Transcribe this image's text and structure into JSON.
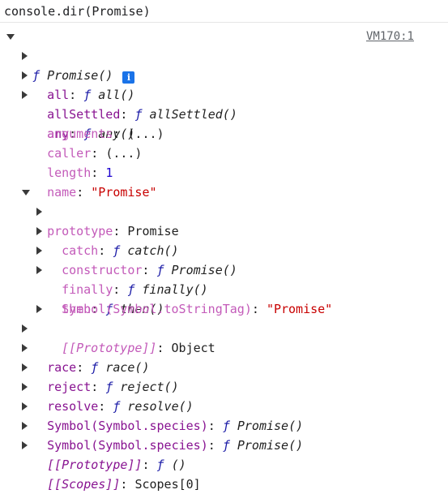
{
  "command": "console.dir(Promise)",
  "source_link": "VM170:1",
  "root": {
    "f": "ƒ",
    "name": "Promise()",
    "info_icon": "i"
  },
  "rows": [
    {
      "key": "all",
      "sep": ": ",
      "f": "ƒ",
      "val": "all()"
    },
    {
      "key": "allSettled",
      "sep": ": ",
      "f": "ƒ",
      "val": "allSettled()"
    },
    {
      "key": "any",
      "sep": ": ",
      "f": "ƒ",
      "val": "any()"
    },
    {
      "key": "arguments",
      "sep": ": ",
      "val": "(...)"
    },
    {
      "key": "caller",
      "sep": ": ",
      "val": "(...)"
    },
    {
      "key": "length",
      "sep": ": ",
      "val": "1"
    },
    {
      "key": "name",
      "sep": ": ",
      "val": "\"Promise\""
    },
    {
      "key": "prototype",
      "sep": ": ",
      "val": "Promise"
    },
    {
      "key": "catch",
      "sep": ": ",
      "f": "ƒ",
      "val": "catch()"
    },
    {
      "key": "constructor",
      "sep": ": ",
      "f": "ƒ",
      "val": "Promise()"
    },
    {
      "key": "finally",
      "sep": ": ",
      "f": "ƒ",
      "val": "finally()"
    },
    {
      "key": "then",
      "sep": ": ",
      "f": "ƒ",
      "val": "then()"
    },
    {
      "key": "Symbol(Symbol.toStringTag)",
      "sep": ": ",
      "val": "\"Promise\""
    },
    {
      "key": "[[Prototype]]",
      "sep": ": ",
      "val": "Object"
    },
    {
      "key": "race",
      "sep": ": ",
      "f": "ƒ",
      "val": "race()"
    },
    {
      "key": "reject",
      "sep": ": ",
      "f": "ƒ",
      "val": "reject()"
    },
    {
      "key": "resolve",
      "sep": ": ",
      "f": "ƒ",
      "val": "resolve()"
    },
    {
      "key": "Symbol(Symbol.species)",
      "sep": ": ",
      "f": "ƒ",
      "val": "Promise()"
    },
    {
      "key": "Symbol(Symbol.species)",
      "sep": ": ",
      "f": "ƒ",
      "val": "Promise()"
    },
    {
      "key": "[[Prototype]]",
      "sep": ": ",
      "f": "ƒ",
      "val": "()"
    },
    {
      "key": "[[Scopes]]",
      "sep": ": ",
      "val": "Scopes[0]"
    }
  ]
}
